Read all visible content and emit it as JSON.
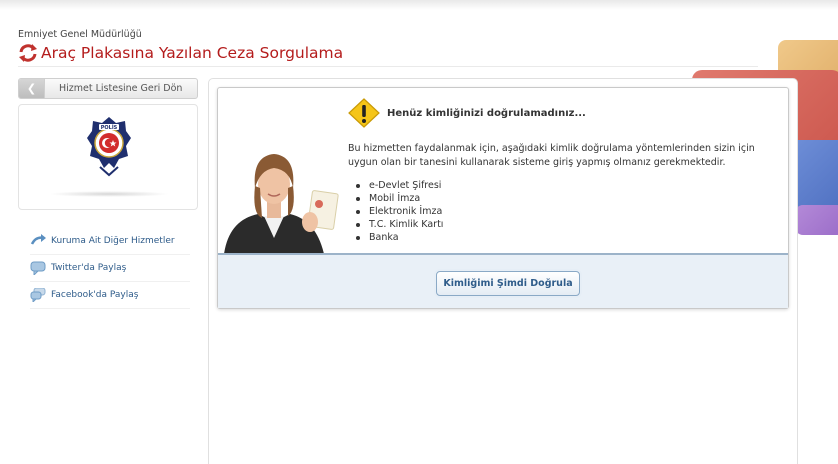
{
  "header": {
    "organization": "Emniyet Genel Müdürlüğü",
    "page_title": "Araç Plakasına Yazılan Ceza Sorgulama"
  },
  "sidebar": {
    "back_button_label": "Hizmet Listesine Geri Dön",
    "links": [
      {
        "label": "Kuruma Ait Diğer Hizmetler",
        "icon": "return-arrow-icon"
      },
      {
        "label": "Twitter'da Paylaş",
        "icon": "speech-bubble-icon"
      },
      {
        "label": "Facebook'da Paylaş",
        "icon": "speech-bubbles-icon"
      }
    ]
  },
  "notice": {
    "title": "Henüz kimliğinizi doğrulamadınız...",
    "description": "Bu hizmetten faydalanmak için, aşağıdaki kimlik doğrulama yöntemlerinden sizin için uygun olan bir tanesini kullanarak sisteme giriş yapmış olmanız gerekmektedir.",
    "methods": [
      "e-Devlet Şifresi",
      "Mobil İmza",
      "Elektronik İmza",
      "T.C. Kimlik Kartı",
      "Banka"
    ],
    "verify_button_label": "Kimliğimi Şimdi Doğrula"
  },
  "colors": {
    "title_red": "#b41c1c",
    "link_blue": "#2f5c8a",
    "panel_blue": "#e9f0f7"
  }
}
